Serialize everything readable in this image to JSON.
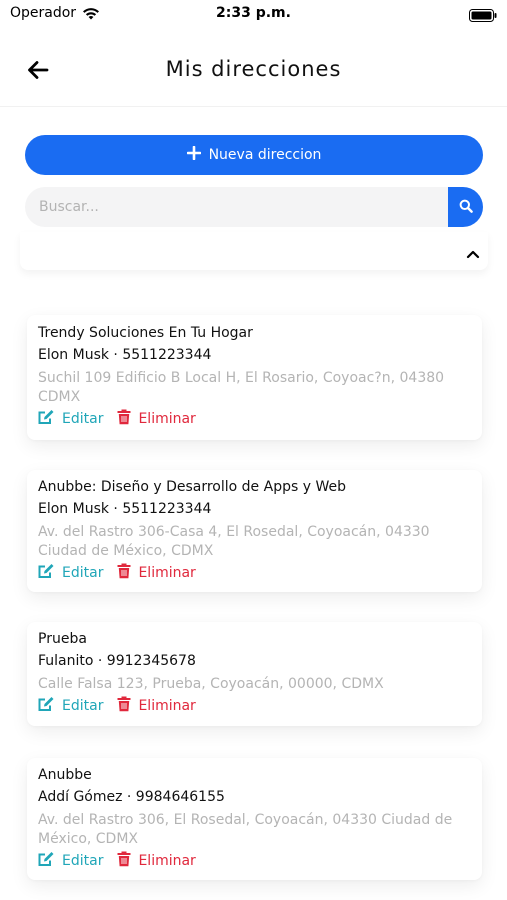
{
  "status_bar": {
    "carrier": "Operador",
    "time": "2:33 p.m."
  },
  "header": {
    "title": "Mis direcciones"
  },
  "actions": {
    "new_address_label": "Nueva direccion"
  },
  "search": {
    "placeholder": "Buscar...",
    "value": ""
  },
  "addresses": [
    {
      "title": "Trendy Soluciones En Tu Hogar",
      "contact": "Elon Musk · 5511223344",
      "address": "Suchil 109 Edificio B Local H, El Rosario, Coyoac?n, 04380 CDMX",
      "edit_label": "Editar",
      "delete_label": "Eliminar"
    },
    {
      "title": "Anubbe: Diseño y Desarrollo de Apps y Web",
      "contact": "Elon Musk · 5511223344",
      "address": "Av. del Rastro 306-Casa 4, El Rosedal, Coyoacán, 04330 Ciudad de México, CDMX",
      "edit_label": "Editar",
      "delete_label": "Eliminar"
    },
    {
      "title": "Prueba",
      "contact": "Fulanito · 9912345678",
      "address": "Calle Falsa 123, Prueba, Coyoacán, 00000, CDMX",
      "edit_label": "Editar",
      "delete_label": "Eliminar"
    },
    {
      "title": "Anubbe",
      "contact": "Addí Gómez · 9984646155",
      "address": "Av. del Rastro 306, El Rosedal, Coyoacán, 04330 Ciudad de México, CDMX",
      "edit_label": "Editar",
      "delete_label": "Eliminar"
    }
  ],
  "colors": {
    "primary": "#1a6cf2",
    "edit": "#20a6b8",
    "delete": "#e0283c",
    "muted_text": "#b4b4b4"
  },
  "icons": {
    "back": "arrow-left-icon",
    "plus": "plus-icon",
    "search": "search-icon",
    "collapse": "chevron-up-icon",
    "edit": "edit-icon",
    "delete": "trash-icon"
  }
}
